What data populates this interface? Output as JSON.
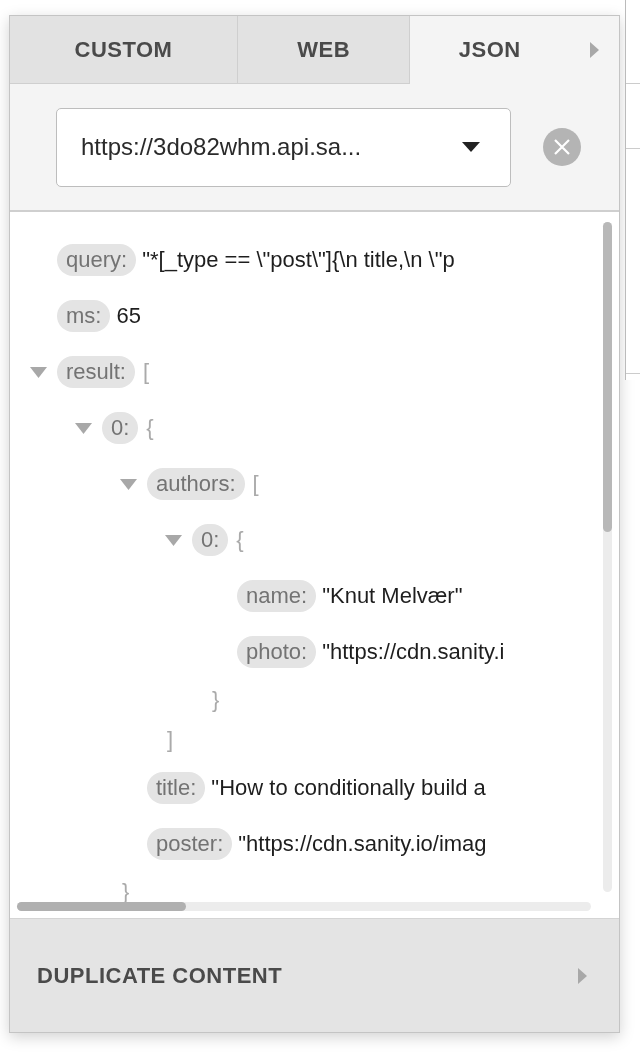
{
  "tabs": [
    {
      "label": "CUSTOM",
      "selected": false
    },
    {
      "label": "WEB",
      "selected": false
    },
    {
      "label": "JSON",
      "selected": true
    }
  ],
  "endpoint": {
    "value": "https://3do82whm.api.sa..."
  },
  "tree": [
    {
      "key": "query:",
      "value": "\"*[_type == \\\"post\\\"]{\\n title,\\n \\\"p"
    },
    {
      "key": "ms:",
      "value": "65"
    },
    {
      "key": "result:",
      "open": "[",
      "expanded": true,
      "children": [
        {
          "key": "0:",
          "open": "{",
          "expanded": true,
          "close": "}",
          "children": [
            {
              "key": "authors:",
              "open": "[",
              "expanded": true,
              "close": "]",
              "children": [
                {
                  "key": "0:",
                  "open": "{",
                  "expanded": true,
                  "close": "}",
                  "children": [
                    {
                      "key": "name:",
                      "value": "\"Knut Melvær\""
                    },
                    {
                      "key": "photo:",
                      "value": "\"https://cdn.sanity.i"
                    }
                  ]
                }
              ]
            },
            {
              "key": "title:",
              "value": "\"How to conditionally build a"
            },
            {
              "key": "poster:",
              "value": "\"https://cdn.sanity.io/imag"
            }
          ]
        }
      ]
    }
  ],
  "footer": {
    "label": "DUPLICATE CONTENT"
  }
}
